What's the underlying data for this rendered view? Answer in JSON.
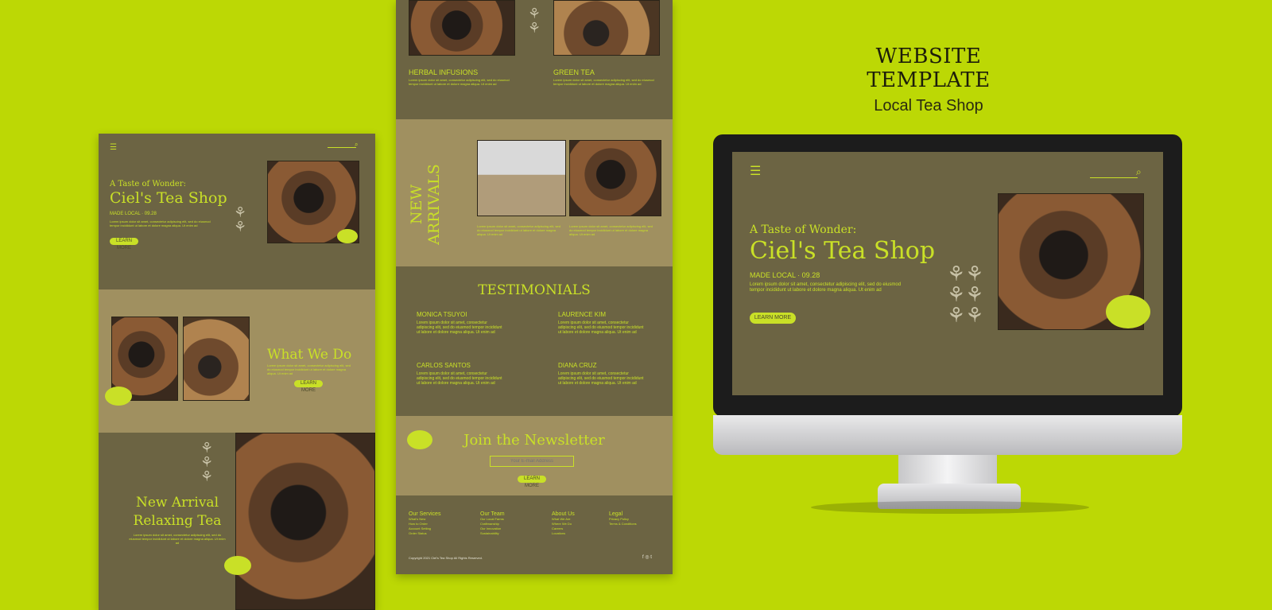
{
  "header": {
    "title": "WEBSITE TEMPLATE",
    "subtitle": "Local Tea Shop"
  },
  "hero": {
    "tagline": "A Taste of Wonder:",
    "shop_name": "Ciel's Tea Shop",
    "made_local": "MADE LOCAL · 09.28",
    "body": "Lorem ipsum dolor sit amet, consectetur adipiscing elit, sed do eiusmod tempor incididunt ut labore et dolore magna aliqua. Ut enim ad",
    "cta": "LEARN MORE"
  },
  "what_we_do": {
    "title": "What We Do",
    "cta": "LEARN MORE"
  },
  "new_arrival": {
    "title_line1": "New Arrival",
    "title_line2": "Relaxing Tea"
  },
  "categories": [
    "HERBAL INFUSIONS",
    "GREEN TEA"
  ],
  "new_arrivals_label": "NEW ARRIVALS",
  "testimonials": {
    "title": "TESTIMONIALS",
    "people": [
      {
        "name": "MONICA TSUYOI",
        "quote": "Lorem ipsum dolor sit amet, consectetur adipiscing elit, sed do eiusmod tempor incididunt ut labore et dolore magna aliqua. Ut enim ad"
      },
      {
        "name": "LAURENCE KIM",
        "quote": "Lorem ipsum dolor sit amet, consectetur adipiscing elit, sed do eiusmod tempor incididunt ut labore et dolore magna aliqua. Ut enim ad"
      },
      {
        "name": "CARLOS SANTOS",
        "quote": "Lorem ipsum dolor sit amet, consectetur adipiscing elit, sed do eiusmod tempor incididunt ut labore et dolore magna aliqua. Ut enim ad"
      },
      {
        "name": "DIANA CRUZ",
        "quote": "Lorem ipsum dolor sit amet, consectetur adipiscing elit, sed do eiusmod tempor incididunt ut labore et dolore magna aliqua. Ut enim ad"
      }
    ]
  },
  "newsletter": {
    "title": "Join the Newsletter",
    "placeholder": "Your E-mail Address",
    "cta": "LEARN MORE"
  },
  "footer": {
    "columns": [
      {
        "title": "Our Services",
        "items": [
          "What's New",
          "How to Order",
          "Account Setting",
          "Order Status"
        ]
      },
      {
        "title": "Our Team",
        "items": [
          "Our Local Farms",
          "Craftmanship",
          "Our Innovation",
          "Sustainability"
        ]
      },
      {
        "title": "About Us",
        "items": [
          "What We Are",
          "Where We Do",
          "Careers",
          "Locations"
        ]
      },
      {
        "title": "Legal",
        "items": [
          "Privacy Policy",
          "Terms & Conditions"
        ]
      }
    ],
    "copyright": "Copyright 2021 Ciel's Tea Shop All Rights Reserved.",
    "social": "f ◎ t"
  },
  "colors": {
    "background": "#bcd805",
    "accent": "#c9e027",
    "panel_dark": "#6c6443",
    "panel_light": "#a09060"
  }
}
